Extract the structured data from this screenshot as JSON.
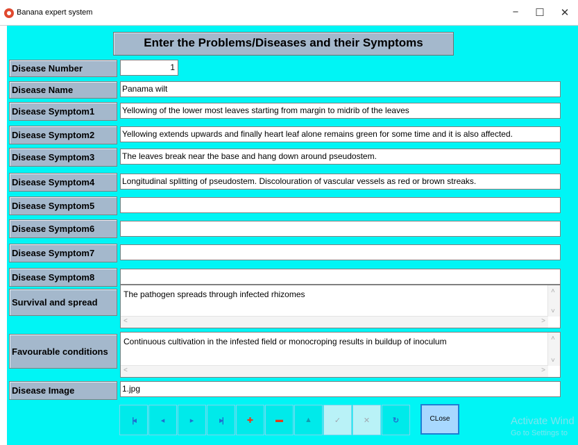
{
  "window": {
    "title": "Banana expert system",
    "minimize": "−",
    "maximize": "☐",
    "close": "✕"
  },
  "header": "Enter the Problems/Diseases and their Symptoms",
  "labels": {
    "disease_number": "Disease Number",
    "disease_name": "Disease Name",
    "symptom1": "Disease Symptom1",
    "symptom2": "Disease Symptom2",
    "symptom3": "Disease Symptom3",
    "symptom4": "Disease Symptom4",
    "symptom5": "Disease Symptom5",
    "symptom6": "Disease Symptom6",
    "symptom7": "Disease Symptom7",
    "symptom8": "Disease Symptom8",
    "survival": "Survival and spread",
    "favourable": "Favourable conditions",
    "image": "Disease Image"
  },
  "values": {
    "disease_number": "1",
    "disease_name": "Panama wilt",
    "symptom1": "Yellowing of the lower most leaves starting from margin to midrib of the leaves",
    "symptom2": "Yellowing extends upwards and finally heart leaf alone remains green for some time and it is also affected.",
    "symptom3": "The leaves break near the base and hang down around pseudostem.",
    "symptom4": "Longitudinal splitting of pseudostem. Discolouration of vascular vessels as red or brown streaks.",
    "symptom5": "",
    "symptom6": "",
    "symptom7": "",
    "symptom8": "",
    "survival": "The pathogen spreads through infected rhizomes",
    "favourable": "Continuous cultivation in the infested field or monocroping results in buildup of inoculum",
    "image": "1.jpg"
  },
  "scroll_arrows": {
    "up": "˄",
    "down": "˅",
    "left": "˂",
    "right": "˃"
  },
  "navigator": {
    "first": "◂",
    "prior": "◂",
    "next": "▸",
    "last": "▸",
    "insert": "✚",
    "delete": "▬",
    "edit": "▲",
    "post": "✓",
    "cancel": "✕",
    "refresh": "↻"
  },
  "close_button": "CLose",
  "watermark": {
    "line1": "Activate Wind",
    "line2": "Go to Settings to"
  },
  "colors": {
    "background": "#00f5f5",
    "label_bg": "#a4b8cc",
    "nav_icon": "#1f6fd1",
    "nav_accent": "#e53b1a"
  }
}
